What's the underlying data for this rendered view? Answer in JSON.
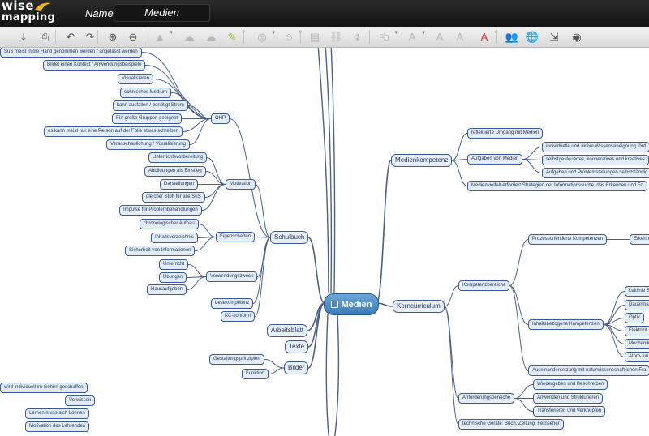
{
  "app": {
    "logo_line1": "wise",
    "logo_line2": "mapping",
    "name_label": "Name:",
    "name_value": "Medien"
  },
  "toolbar": [
    {
      "icon": "download-icon",
      "glyph": "⤓"
    },
    {
      "icon": "print-icon",
      "glyph": "⎙"
    },
    {
      "icon": "undo-icon",
      "glyph": "↶"
    },
    {
      "icon": "redo-icon",
      "glyph": "↷"
    },
    {
      "icon": "zoom-in-icon",
      "glyph": "⊕"
    },
    {
      "icon": "zoom-out-icon",
      "glyph": "⊖"
    },
    {
      "icon": "node-shape-icon",
      "glyph": "▲"
    },
    {
      "icon": "add-topic-icon",
      "glyph": "☁"
    },
    {
      "icon": "delete-topic-icon",
      "glyph": "☁"
    },
    {
      "icon": "border-color-icon",
      "glyph": "✎"
    },
    {
      "icon": "topic-color-icon",
      "glyph": "◍"
    },
    {
      "icon": "icon-picker-icon",
      "glyph": "☺"
    },
    {
      "icon": "note-icon",
      "glyph": "▤"
    },
    {
      "icon": "link-icon",
      "glyph": "⛓"
    },
    {
      "icon": "relationship-icon",
      "glyph": "↯"
    },
    {
      "icon": "font-family-icon",
      "glyph": "ᵃb"
    },
    {
      "icon": "font-size-icon",
      "glyph": "A"
    },
    {
      "icon": "bold-icon",
      "glyph": "A"
    },
    {
      "icon": "italic-icon",
      "glyph": "A"
    },
    {
      "icon": "font-color-icon",
      "glyph": "A"
    },
    {
      "icon": "share-icon",
      "glyph": "👥"
    },
    {
      "icon": "publish-icon",
      "glyph": "🌐"
    },
    {
      "icon": "export-icon",
      "glyph": "⇲"
    },
    {
      "icon": "history-icon",
      "glyph": "◉"
    }
  ],
  "colors": {
    "topbar": "#1c1c1c",
    "node_bg": "#e3ecf8",
    "node_border": "#3b5a9a",
    "center": "#3a7cb8",
    "line": "#4b6088"
  },
  "center": {
    "label": "Medien"
  },
  "nodes": [
    {
      "id": "sus",
      "label": "SuS meist in die Hand genommen werden / angefasst werden"
    },
    {
      "id": "kontext",
      "label": "Bildet einen Kontext / Anwendungsbeispiele"
    },
    {
      "id": "visual",
      "label": "Visualisieren"
    },
    {
      "id": "techn",
      "label": "echnisches Medium"
    },
    {
      "id": "ausfallen",
      "label": "kann ausfallen / benötigt Strom"
    },
    {
      "id": "gruppen",
      "label": "Für große Gruppen geeignet"
    },
    {
      "id": "person",
      "label": "es kann meist nur eine Person auf der Folie etwas schreiben"
    },
    {
      "id": "veransch",
      "label": "Veranschaulichung / Visualisierung"
    },
    {
      "id": "ohp",
      "label": "OHP"
    },
    {
      "id": "unterrichtsvorb",
      "label": "Unterrichtsvorbereitung"
    },
    {
      "id": "abbild",
      "label": "Abbildungen als Einstieg"
    },
    {
      "id": "darst",
      "label": "Darstellungen"
    },
    {
      "id": "gleicher",
      "label": "gleicher Stoff für alle SuS"
    },
    {
      "id": "impulse",
      "label": "Impulse für Problembehandlungen"
    },
    {
      "id": "motivation",
      "label": "Motivation"
    },
    {
      "id": "chrono",
      "label": "chronologischer Aufbau"
    },
    {
      "id": "inhalts",
      "label": "Inhaltsverzeichnis"
    },
    {
      "id": "sicherheit",
      "label": "Sicherheit von Informationen"
    },
    {
      "id": "eigensch",
      "label": "Eigenschaften"
    },
    {
      "id": "unterricht",
      "label": "Unterricht"
    },
    {
      "id": "uebungen",
      "label": "Übungen"
    },
    {
      "id": "haus",
      "label": "Hausaufgaben"
    },
    {
      "id": "verwend",
      "label": "Verwendungszweck"
    },
    {
      "id": "lese",
      "label": "Lesekompetenz"
    },
    {
      "id": "kc",
      "label": "KC-konform"
    },
    {
      "id": "schulbuch",
      "label": "Schulbuch"
    },
    {
      "id": "arbeitsblatt",
      "label": "Arbeitsblatt"
    },
    {
      "id": "texte",
      "label": "Texte"
    },
    {
      "id": "gestalt",
      "label": "Gestaltungsprinzipien"
    },
    {
      "id": "funktion",
      "label": "Funktion"
    },
    {
      "id": "bilder",
      "label": "Bilder"
    },
    {
      "id": "individuell",
      "label": "wird individuell im Gehirn geschaffen"
    },
    {
      "id": "vorwissen",
      "label": "Vorwissen"
    },
    {
      "id": "lernen",
      "label": "Lernen muss sich Lohnen"
    },
    {
      "id": "motiv2",
      "label": "Motivation des Lehrenden"
    },
    {
      "id": "medienkomp",
      "label": "Medienkompetenz"
    },
    {
      "id": "reflekt",
      "label": "reflektierte Umgang mit Medien"
    },
    {
      "id": "aufgaben",
      "label": "Aufgaben von Medien"
    },
    {
      "id": "indiv2",
      "label": "individuelle und aktive Wissensaneignung förd"
    },
    {
      "id": "selbst",
      "label": "selbstgesteuertes, kooperatives und kreatives"
    },
    {
      "id": "aufgprob",
      "label": "Aufgaben und Problemstellungen selbstständig"
    },
    {
      "id": "vielfalt",
      "label": "Medienvielfalt erfordert Strategien der Informationssuche, das Erkennen und Fo"
    },
    {
      "id": "kerncurr",
      "label": "Kerncurriculum"
    },
    {
      "id": "kompbereiche",
      "label": "Kompetenzbereiche"
    },
    {
      "id": "prozess",
      "label": "Prozessorientierte Kompetenzen"
    },
    {
      "id": "erkenn",
      "label": "Erkennt"
    },
    {
      "id": "inhaltsbez",
      "label": "Inhaltsbezogene Kompetenzen"
    },
    {
      "id": "leitlinie",
      "label": "Leitlinie S"
    },
    {
      "id": "dauerm",
      "label": "Dauerma"
    },
    {
      "id": "optik",
      "label": "Optik"
    },
    {
      "id": "elektri",
      "label": "Elektrizit"
    },
    {
      "id": "mechanik",
      "label": "Mechanik"
    },
    {
      "id": "atom",
      "label": "Atom- un"
    },
    {
      "id": "ausein",
      "label": "Auseinandersetzung mit naturwissenschaftlichen Fra"
    },
    {
      "id": "anford",
      "label": "Anforderungsbereiche"
    },
    {
      "id": "wiedergeben",
      "label": "Wiedergeben und Beschreiben"
    },
    {
      "id": "anwenden",
      "label": "Anwenden und Strukturieren"
    },
    {
      "id": "transfer",
      "label": "Transferieren und Verknüpfen"
    },
    {
      "id": "techgeraete",
      "label": "technische Geräte: Buch, Zeitung, Fernseher"
    }
  ]
}
